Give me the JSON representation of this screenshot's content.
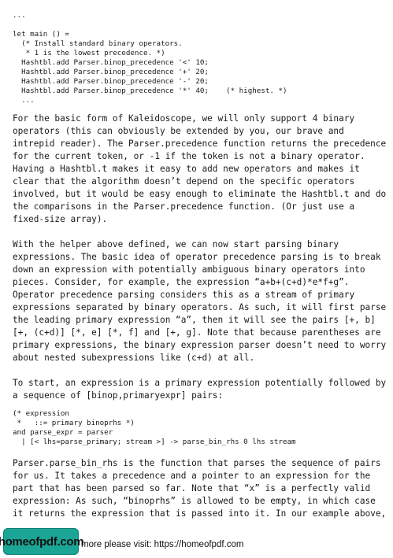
{
  "code_block_1": [
    "...",
    "",
    "let main () =",
    "  (* Install standard binary operators.",
    "   * 1 is the lowest precedence. *)",
    "  Hashtbl.add Parser.binop_precedence '<' 10;",
    "  Hashtbl.add Parser.binop_precedence '+' 20;",
    "  Hashtbl.add Parser.binop_precedence '-' 20;",
    "  Hashtbl.add Parser.binop_precedence '*' 40;    (* highest. *)",
    "  ..."
  ],
  "paragraph_1": [
    "For the basic form of Kaleidoscope, we will only support 4 binary",
    "operators (this can obviously be extended by you, our brave and",
    "intrepid reader). The Parser.precedence function returns the precedence",
    "for the current token, or -1 if the token is not a binary operator.",
    "Having a Hashtbl.t makes it easy to add new operators and makes it",
    "clear that the algorithm doesn’t depend on the specific operators",
    "involved, but it would be easy enough to eliminate the Hashtbl.t and do",
    "the comparisons in the Parser.precedence function. (Or just use a",
    "fixed-size array)."
  ],
  "paragraph_2": [
    "With the helper above defined, we can now start parsing binary",
    "expressions. The basic idea of operator precedence parsing is to break",
    "down an expression with potentially ambiguous binary operators into",
    "pieces. Consider, for example, the expression “a+b+(c+d)*e*f+g”.",
    "Operator precedence parsing considers this as a stream of primary",
    "expressions separated by binary operators. As such, it will first parse",
    "the leading primary expression “a”, then it will see the pairs [+, b]",
    "[+, (c+d)] [*, e] [*, f] and [+, g]. Note that because parentheses are",
    "primary expressions, the binary expression parser doesn’t need to worry",
    "about nested subexpressions like (c+d) at all."
  ],
  "paragraph_3": [
    "To start, an expression is a primary expression potentially followed by",
    "a sequence of [binop,primaryexpr] pairs:"
  ],
  "code_block_2": [
    "(* expression",
    " *   ::= primary binoprhs *)",
    "and parse_expr = parser",
    "  | [< lhs=parse_primary; stream >] -> parse_bin_rhs 0 lhs stream"
  ],
  "paragraph_4": [
    "Parser.parse_bin_rhs is the function that parses the sequence of pairs",
    "for us. It takes a precedence and a pointer to an expression for the",
    "part that has been parsed so far. Note that “x” is a perfectly valid",
    "expression: As such, “binoprhs” is allowed to be empty, in which case",
    "it returns the expression that is passed into it. In our example above,"
  ],
  "footer": {
    "logo_text": "homeofpdf.com",
    "visit_text": "more please visit: https://homeofpdf.com"
  },
  "colors": {
    "logo_background": "#1aa595",
    "text": "#1a1a1a",
    "page_background": "#ffffff"
  }
}
